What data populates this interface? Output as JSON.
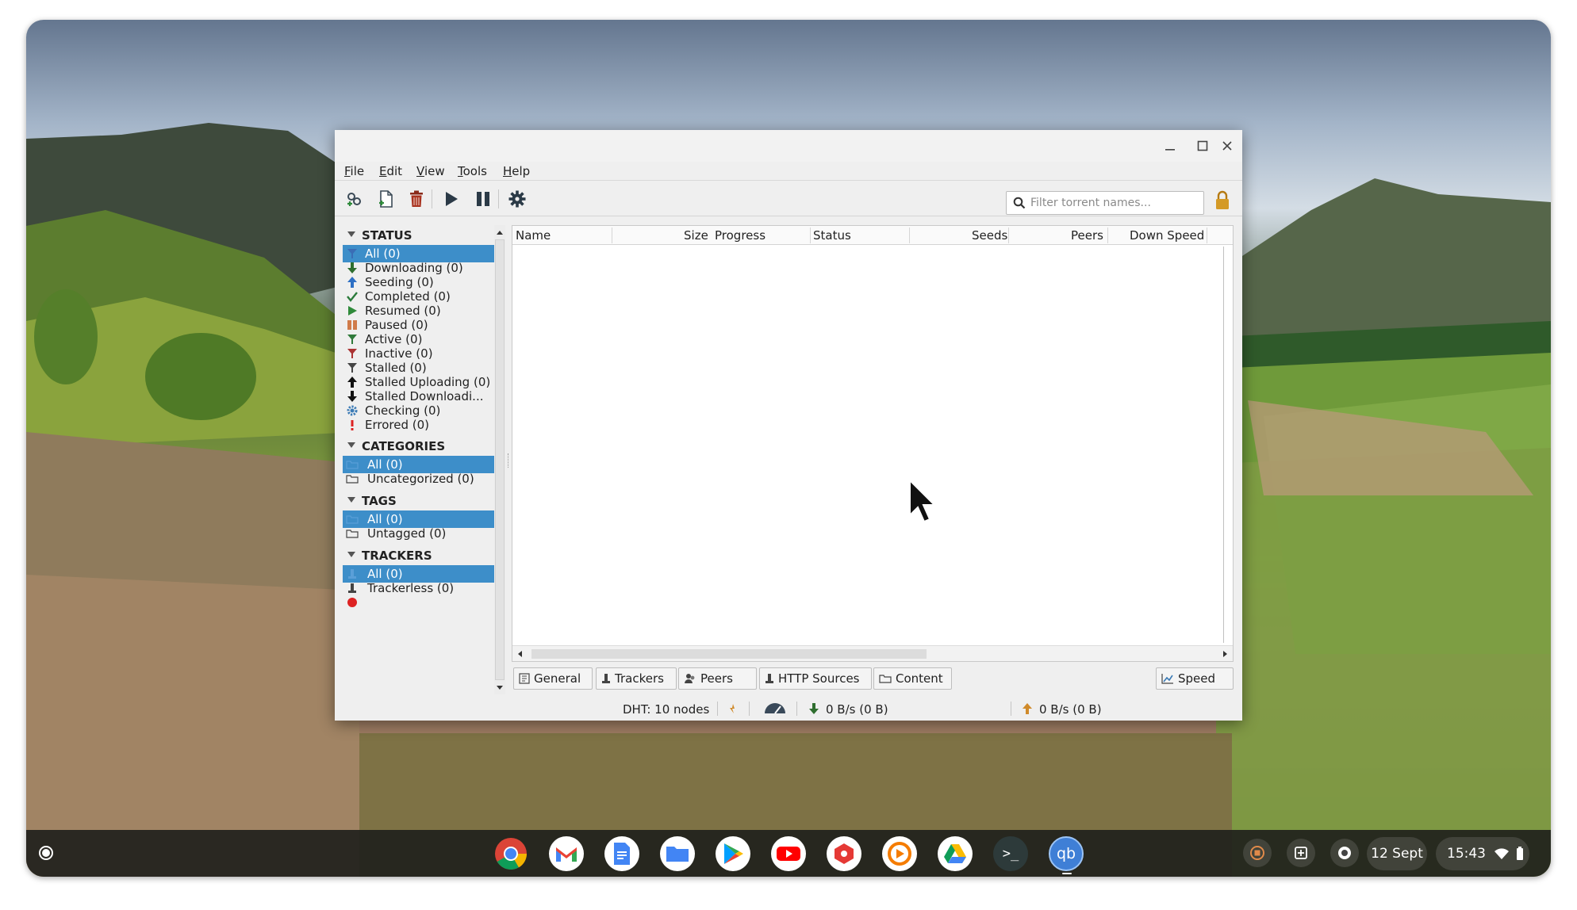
{
  "menu": {
    "items": [
      {
        "label_pre": "",
        "label_u": "F",
        "label_post": "ile"
      },
      {
        "label_pre": "",
        "label_u": "E",
        "label_post": "dit"
      },
      {
        "label_pre": "",
        "label_u": "V",
        "label_post": "iew"
      },
      {
        "label_pre": "",
        "label_u": "T",
        "label_post": "ools"
      },
      {
        "label_pre": "",
        "label_u": "H",
        "label_post": "elp"
      }
    ]
  },
  "toolbar": {
    "search_placeholder": "Filter torrent names..."
  },
  "sidebar": {
    "status_title": "STATUS",
    "status_items": [
      {
        "label": "All (0)",
        "icon": "filter-icon",
        "color": "#3a6db5"
      },
      {
        "label": "Downloading (0)",
        "icon": "download-arrow-icon",
        "color": "#2f6e2f"
      },
      {
        "label": "Seeding (0)",
        "icon": "upload-arrow-icon",
        "color": "#2d6fc4"
      },
      {
        "label": "Completed (0)",
        "icon": "checkmark-icon",
        "color": "#2a7a3a"
      },
      {
        "label": "Resumed (0)",
        "icon": "play-icon",
        "color": "#2f8a3a"
      },
      {
        "label": "Paused (0)",
        "icon": "pause-icon",
        "color": "#d07b4a"
      },
      {
        "label": "Active (0)",
        "icon": "filter-icon",
        "color": "#2f7a3a"
      },
      {
        "label": "Inactive (0)",
        "icon": "filter-icon",
        "color": "#a33"
      },
      {
        "label": "Stalled (0)",
        "icon": "filter-icon",
        "color": "#444"
      },
      {
        "label": "Stalled Uploading (0)",
        "icon": "upload-arrow-icon",
        "color": "#111"
      },
      {
        "label": "Stalled Downloadi...",
        "icon": "download-arrow-icon",
        "color": "#111"
      },
      {
        "label": "Checking (0)",
        "icon": "gear-icon",
        "color": "#3a7ab5"
      },
      {
        "label": "Errored (0)",
        "icon": "exclamation-icon",
        "color": "#d22"
      }
    ],
    "categories_title": "CATEGORIES",
    "category_items": [
      {
        "label": "All (0)"
      },
      {
        "label": "Uncategorized (0)"
      }
    ],
    "tags_title": "TAGS",
    "tag_items": [
      {
        "label": "All (0)"
      },
      {
        "label": "Untagged (0)"
      }
    ],
    "trackers_title": "TRACKERS",
    "tracker_items": [
      {
        "label": "All (0)"
      },
      {
        "label": "Trackerless (0)"
      }
    ]
  },
  "list": {
    "columns": [
      "Name",
      "Size",
      "Progress",
      "Status",
      "Seeds",
      "Peers",
      "Down Speed"
    ]
  },
  "tabs": {
    "general": "General",
    "trackers": "Trackers",
    "peers": "Peers",
    "http_sources": "HTTP Sources",
    "content": "Content",
    "speed": "Speed"
  },
  "statusbar": {
    "dht": "DHT: 10 nodes",
    "download": "0 B/s (0 B)",
    "upload": "0 B/s (0 B)"
  },
  "shelf": {
    "date": "12 Sept",
    "time": "15:43",
    "apps": [
      "chrome-icon",
      "gmail-icon",
      "docs-icon",
      "files-icon",
      "play-store-icon",
      "youtube-icon",
      "red-app-icon",
      "orange-app-icon",
      "google-drive-icon",
      "terminal-icon",
      "qbittorrent-icon"
    ],
    "terminal_glyph": ">_",
    "qb_glyph": "qb"
  },
  "colors": {
    "selection": "#3d8ec9",
    "accent_lock": "#c98a1a"
  }
}
